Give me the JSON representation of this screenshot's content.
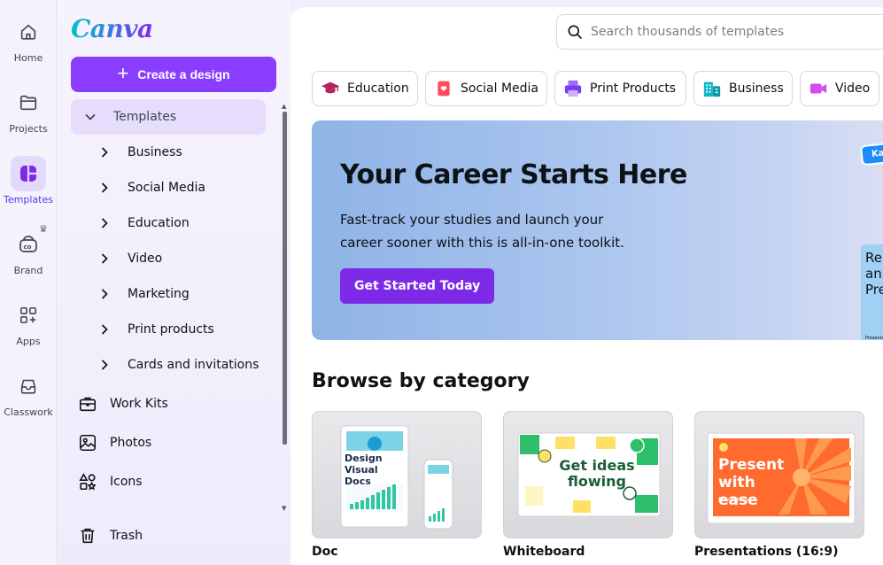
{
  "rail": [
    {
      "label": "Home",
      "icon": "home-icon"
    },
    {
      "label": "Projects",
      "icon": "folder-icon"
    },
    {
      "label": "Templates",
      "icon": "templates-icon",
      "active": true
    },
    {
      "label": "Brand",
      "icon": "brand-icon"
    },
    {
      "label": "Apps",
      "icon": "apps-icon"
    },
    {
      "label": "Classwork",
      "icon": "classwork-icon"
    }
  ],
  "brand": {
    "logo": "Canva",
    "accent": "#8b3dff"
  },
  "sidebar": {
    "create_label": "Create a design",
    "templates_label": "Templates",
    "template_children": [
      "Business",
      "Social Media",
      "Education",
      "Video",
      "Marketing",
      "Print products",
      "Cards and invitations"
    ],
    "links": [
      {
        "label": "Work Kits",
        "icon": "briefcase-icon"
      },
      {
        "label": "Photos",
        "icon": "image-icon"
      },
      {
        "label": "Icons",
        "icon": "shapes-icon"
      }
    ],
    "trash_label": "Trash"
  },
  "search": {
    "placeholder": "Search thousands of templates"
  },
  "chips": [
    {
      "label": "Education",
      "icon": "graduation-cap-icon",
      "color": "#b0245b"
    },
    {
      "label": "Social Media",
      "icon": "heart-icon",
      "color": "#ff4d5e"
    },
    {
      "label": "Print Products",
      "icon": "printer-icon",
      "color": "#7a3cf0"
    },
    {
      "label": "Business",
      "icon": "building-icon",
      "color": "#14b8c8"
    },
    {
      "label": "Video",
      "icon": "video-camera-icon",
      "color": "#d24cf0"
    }
  ],
  "hero": {
    "title": "Your Career Starts Here",
    "body": "Fast-track your studies and launch your career sooner with this is all-in-one toolkit.",
    "cta": "Get Started Today",
    "tag": "Kan",
    "card_text": "Re an Pre",
    "card_tiny": "Presenta"
  },
  "browse": {
    "title": "Browse by category",
    "categories": [
      {
        "label": "Doc",
        "thumb_text": "Design Visual Docs"
      },
      {
        "label": "Whiteboard",
        "thumb_text": "Get ideas flowing"
      },
      {
        "label": "Presentations (16:9)",
        "thumb_text": "Present with ease",
        "thumb_small": "Brand deck"
      }
    ]
  }
}
